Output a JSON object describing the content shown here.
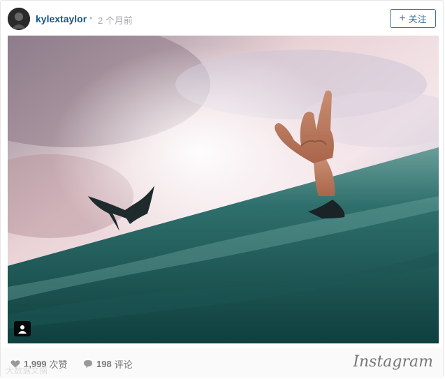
{
  "post": {
    "username": "kylextaylor",
    "separator": "•",
    "time_ago": "2 个月前",
    "follow_label": "关注",
    "follow_icon": "plus-icon"
  },
  "photo": {
    "user_tag_icon": "person-icon"
  },
  "footer": {
    "likes_count": "1,999",
    "likes_label": "次赞",
    "comments_count": "198",
    "comments_label": "评论",
    "brand": "Instagram",
    "watermark": "大数据文摘"
  },
  "colors": {
    "link_blue": "#125688",
    "button_blue": "#3f729b",
    "muted": "#a5a7aa"
  }
}
